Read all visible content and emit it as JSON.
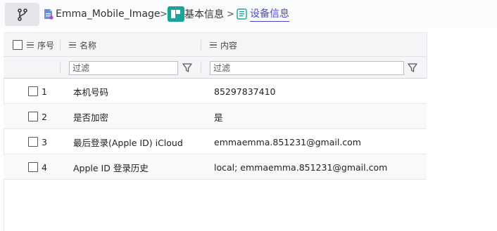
{
  "breadcrumb": {
    "items": [
      {
        "label": "Emma_Mobile_Image",
        "icon": "document-icon"
      },
      {
        "label": "基本信息",
        "icon": "contact-info-icon"
      },
      {
        "label": "设备信息",
        "icon": "device-info-icon",
        "active": true
      }
    ],
    "separator": ">"
  },
  "grid": {
    "columns": [
      {
        "key": "index",
        "label": "序号"
      },
      {
        "key": "name",
        "label": "名称"
      },
      {
        "key": "content",
        "label": "内容"
      }
    ],
    "filter_placeholder": "过滤",
    "rows": [
      {
        "index": "1",
        "name": "本机号码",
        "content": "85297837410"
      },
      {
        "index": "2",
        "name": "是否加密",
        "content": "是"
      },
      {
        "index": "3",
        "name": "最后登录(Apple ID) iCloud",
        "content": "emmaemma.851231@gmail.com"
      },
      {
        "index": "4",
        "name": "Apple ID 登录历史",
        "content": "local; emmaemma.851231@gmail.com"
      }
    ]
  },
  "colors": {
    "accent": "#4e48d8",
    "teal_icon": "#19a39b"
  }
}
